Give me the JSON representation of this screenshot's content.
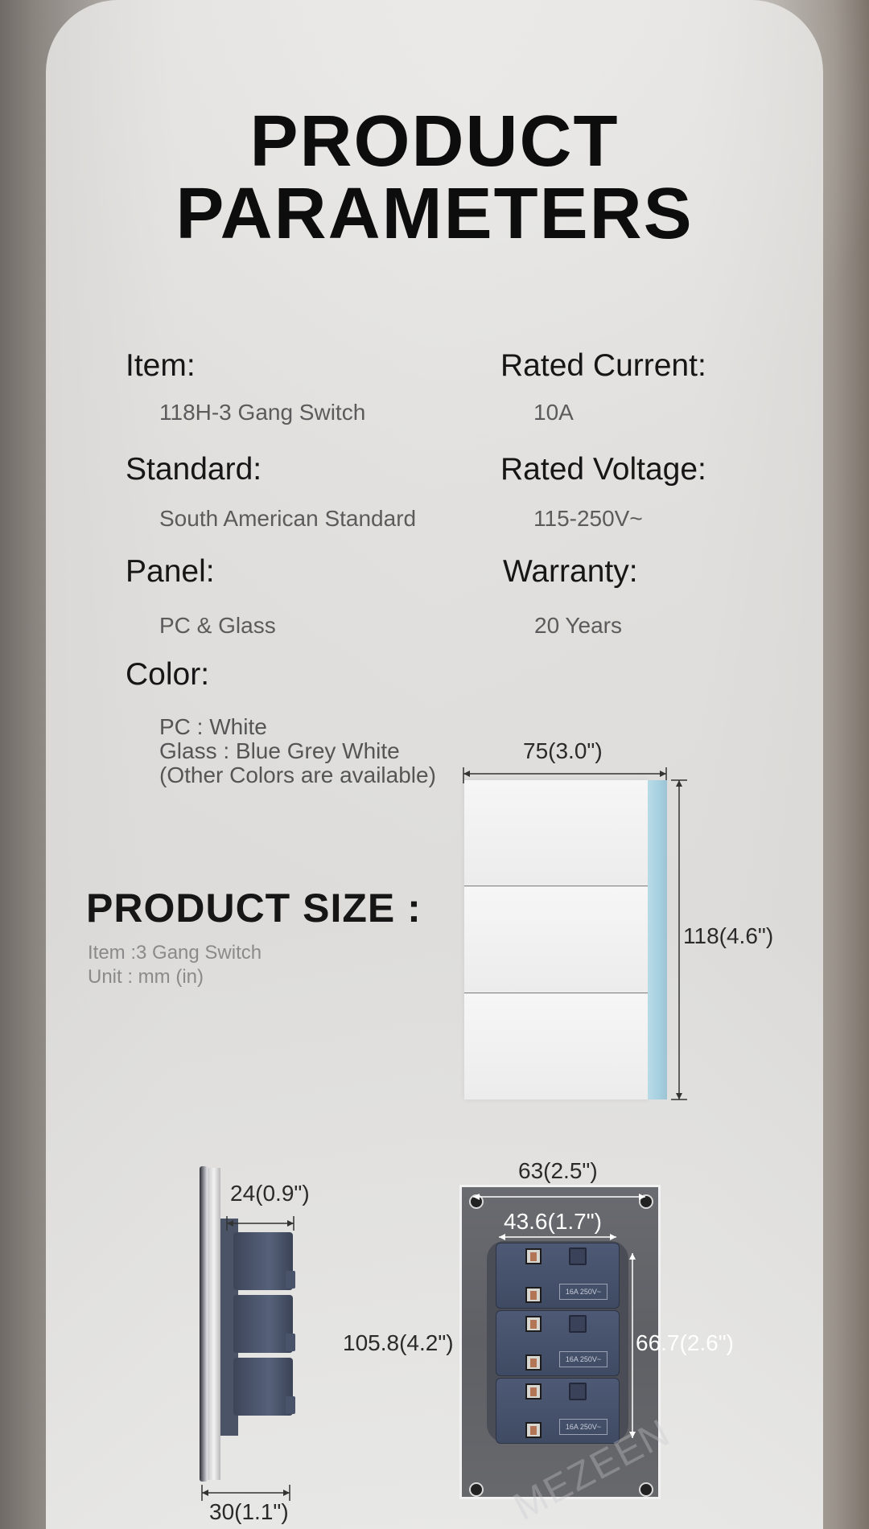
{
  "title": {
    "line1": "PRODUCT",
    "line2": "PARAMETERS"
  },
  "params": {
    "item_label": "Item:",
    "item_value": "118H-3 Gang Switch",
    "standard_label": "Standard:",
    "standard_value": "South American Standard",
    "panel_label": "Panel:",
    "panel_value": "PC & Glass",
    "color_label": "Color:",
    "color_line1": "PC : White",
    "color_line2": "Glass : Blue Grey White",
    "color_line3": "(Other Colors are available)",
    "current_label": "Rated Current:",
    "current_value": "10A",
    "voltage_label": "Rated Voltage:",
    "voltage_value": "115-250V~",
    "warranty_label": "Warranty:",
    "warranty_value": "20 Years"
  },
  "size": {
    "title": "PRODUCT SIZE :",
    "item": "Item :3 Gang Switch",
    "unit": "Unit : mm (in)"
  },
  "dimensions": {
    "front_width": "75(3.0\")",
    "front_height": "118(4.6\")",
    "side_depth": "24(0.9\")",
    "side_total": "30(1.1\")",
    "back_width": "63(2.5\")",
    "back_inner_width": "43.6(1.7\")",
    "back_height": "105.8(4.2\")",
    "back_inner_height": "66.7(2.6\")"
  },
  "back_rating": "16A 250V~",
  "watermark": "MEZEEN",
  "colors": {
    "accent_glass": "#a6cfdf",
    "module": "#46516b"
  }
}
